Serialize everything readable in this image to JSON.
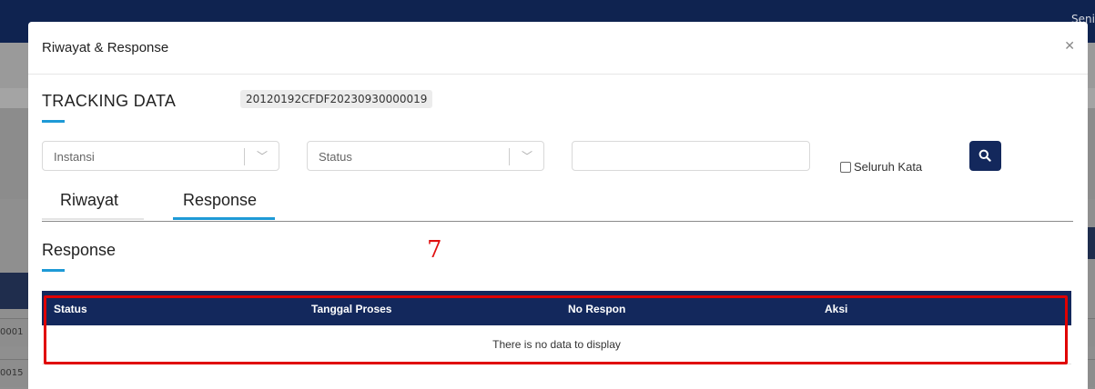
{
  "background": {
    "topbar_text": "Seni",
    "row_fragments": [
      "0001",
      "0015"
    ]
  },
  "modal": {
    "title": "Riwayat & Response",
    "close_icon": "close-icon",
    "tracking_label": "TRACKING DATA",
    "tracking_id": "20120192CFDF20230930000019"
  },
  "filters": {
    "instansi_placeholder": "Instansi",
    "status_placeholder": "Status",
    "search_value": "",
    "checkbox_label": "Seluruh Kata",
    "checkbox_checked": false,
    "search_button_icon": "search-icon"
  },
  "tabs": [
    {
      "label": "Riwayat",
      "active": false
    },
    {
      "label": "Response",
      "active": true
    }
  ],
  "section": {
    "title": "Response",
    "annotation": "7"
  },
  "table": {
    "columns": [
      "Status",
      "Tanggal Proses",
      "No Respon",
      "Aksi"
    ],
    "empty_message": "There is no data to display"
  },
  "colors": {
    "header_navy": "#13285c",
    "accent_blue": "#1e9ad6",
    "annotation_red": "#e01010"
  }
}
